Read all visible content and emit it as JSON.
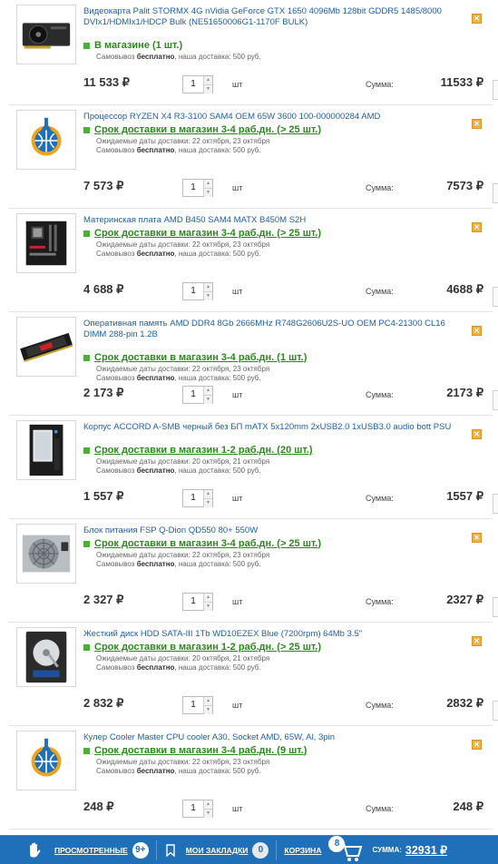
{
  "cart": {
    "items": [
      {
        "title": "Видеокарта Palit STORMX 4G nVidia GeForce GTX 1650 4096Mb 128bit GDDR5 1485/8000 DVIx1/HDMIx1/HDCP Bulk (NE51650006G1-1170F BULK)",
        "availability": "В магазине (1 шт.)",
        "dates": "",
        "pickup_prefix": "Самовывоз",
        "pickup_free": "бесплатно",
        "pickup_suffix": ", наша доставка: 500 руб.",
        "price": "11 533 ₽",
        "qty": "1",
        "unit": "шт",
        "sum_label": "Сумма:",
        "sum": "11533 ₽",
        "thumb_icon": "gpu-image"
      },
      {
        "title": "Процессор RYZEN X4 R3-3100 SAM4 OEM 65W 3600 100-000000284 AMD",
        "availability": "Срок доставки в магазин 3-4 раб.дн. (> 25 шт.)",
        "dates": "Ожидаемые даты доставки: 22 октября, 23 октября",
        "pickup_prefix": "Самовывоз",
        "pickup_free": "бесплатно",
        "pickup_suffix": ", наша доставка: 500 руб.",
        "price": "7 573 ₽",
        "qty": "1",
        "unit": "шт",
        "sum_label": "Сумма:",
        "sum": "7573 ₽",
        "thumb_icon": "placeholder-logo-image"
      },
      {
        "title": "Материнская плата AMD B450 SAM4 MATX B450M S2H",
        "availability": "Срок доставки в магазин 3-4 раб.дн. (> 25 шт.)",
        "dates": "Ожидаемые даты доставки: 22 октября, 23 октября",
        "pickup_prefix": "Самовывоз",
        "pickup_free": "бесплатно",
        "pickup_suffix": ", наша доставка: 500 руб.",
        "price": "4 688 ₽",
        "qty": "1",
        "unit": "шт",
        "sum_label": "Сумма:",
        "sum": "4688 ₽",
        "thumb_icon": "motherboard-image"
      },
      {
        "title": "Оперативная память AMD DDR4 8Gb 2666MHz R748G2606U2S-UO OEM PC4-21300 CL16 DIMM 288-pin 1.2В",
        "availability": "Срок доставки в магазин 3-4 раб.дн. (1 шт.)",
        "dates": "Ожидаемые даты доставки: 22 октября, 23 октября",
        "pickup_prefix": "Самовывоз",
        "pickup_free": "бесплатно",
        "pickup_suffix": ", наша доставка: 500 руб.",
        "price": "2 173 ₽",
        "qty": "1",
        "unit": "шт",
        "sum_label": "Сумма:",
        "sum": "2173 ₽",
        "thumb_icon": "ram-image"
      },
      {
        "title": "Корпус ACCORD A-SMB черный без БП mATX 5x120mm 2xUSB2.0 1xUSB3.0 audio bott PSU",
        "availability": "Срок доставки в магазин 1-2 раб.дн. (20 шт.)",
        "dates": "Ожидаемые даты доставки: 20 октября, 21 октября",
        "pickup_prefix": "Самовывоз",
        "pickup_free": "бесплатно",
        "pickup_suffix": ", наша доставка: 500 руб.",
        "price": "1 557 ₽",
        "qty": "1",
        "unit": "шт",
        "sum_label": "Сумма:",
        "sum": "1557 ₽",
        "thumb_icon": "pc-case-image"
      },
      {
        "title": "Блок питания FSP Q-Dion QD550 80+ 550W",
        "availability": "Срок доставки в магазин 3-4 раб.дн. (> 25 шт.)",
        "dates": "Ожидаемые даты доставки: 22 октября, 23 октября",
        "pickup_prefix": "Самовывоз",
        "pickup_free": "бесплатно",
        "pickup_suffix": ", наша доставка: 500 руб.",
        "price": "2 327 ₽",
        "qty": "1",
        "unit": "шт",
        "sum_label": "Сумма:",
        "sum": "2327 ₽",
        "thumb_icon": "psu-image"
      },
      {
        "title": "Жесткий диск HDD SATA-III 1Tb WD10EZEX Blue (7200rpm) 64Mb 3.5\"",
        "availability": "Срок доставки в магазин 1-2 раб.дн. (> 25 шт.)",
        "dates": "Ожидаемые даты доставки: 20 октября, 21 октября",
        "pickup_prefix": "Самовывоз",
        "pickup_free": "бесплатно",
        "pickup_suffix": ", наша доставка: 500 руб.",
        "price": "2 832 ₽",
        "qty": "1",
        "unit": "шт",
        "sum_label": "Сумма:",
        "sum": "2832 ₽",
        "thumb_icon": "hdd-image"
      },
      {
        "title": "Кулер Cooler Master CPU cooler A30, Socket AMD, 65W, Al, 3pin",
        "availability": "Срок доставки в магазин 3-4 раб.дн. (9 шт.)",
        "dates": "Ожидаемые даты доставки: 22 октября, 23 октября",
        "pickup_prefix": "Самовывоз",
        "pickup_free": "бесплатно",
        "pickup_suffix": ", наша доставка: 500 руб.",
        "price": "248 ₽",
        "qty": "1",
        "unit": "шт",
        "sum_label": "Сумма:",
        "sum": "248 ₽",
        "thumb_icon": "placeholder-logo-image"
      }
    ]
  },
  "bottom_bar": {
    "viewed_label": "ПРОСМОТРЕННЫЕ",
    "viewed_count": "9+",
    "bookmarks_label": "МОИ ЗАКЛАДКИ",
    "bookmarks_count": "0",
    "cart_label": "КОРЗИНА",
    "cart_count": "8",
    "sum_label": "СУММА:",
    "sum_value": "32931 ₽"
  },
  "colors": {
    "link": "#1f5fa8",
    "availability_green": "#2a8a1c",
    "bottom_bar": "#1f6fb9",
    "delete_icon": "#f0b043"
  }
}
